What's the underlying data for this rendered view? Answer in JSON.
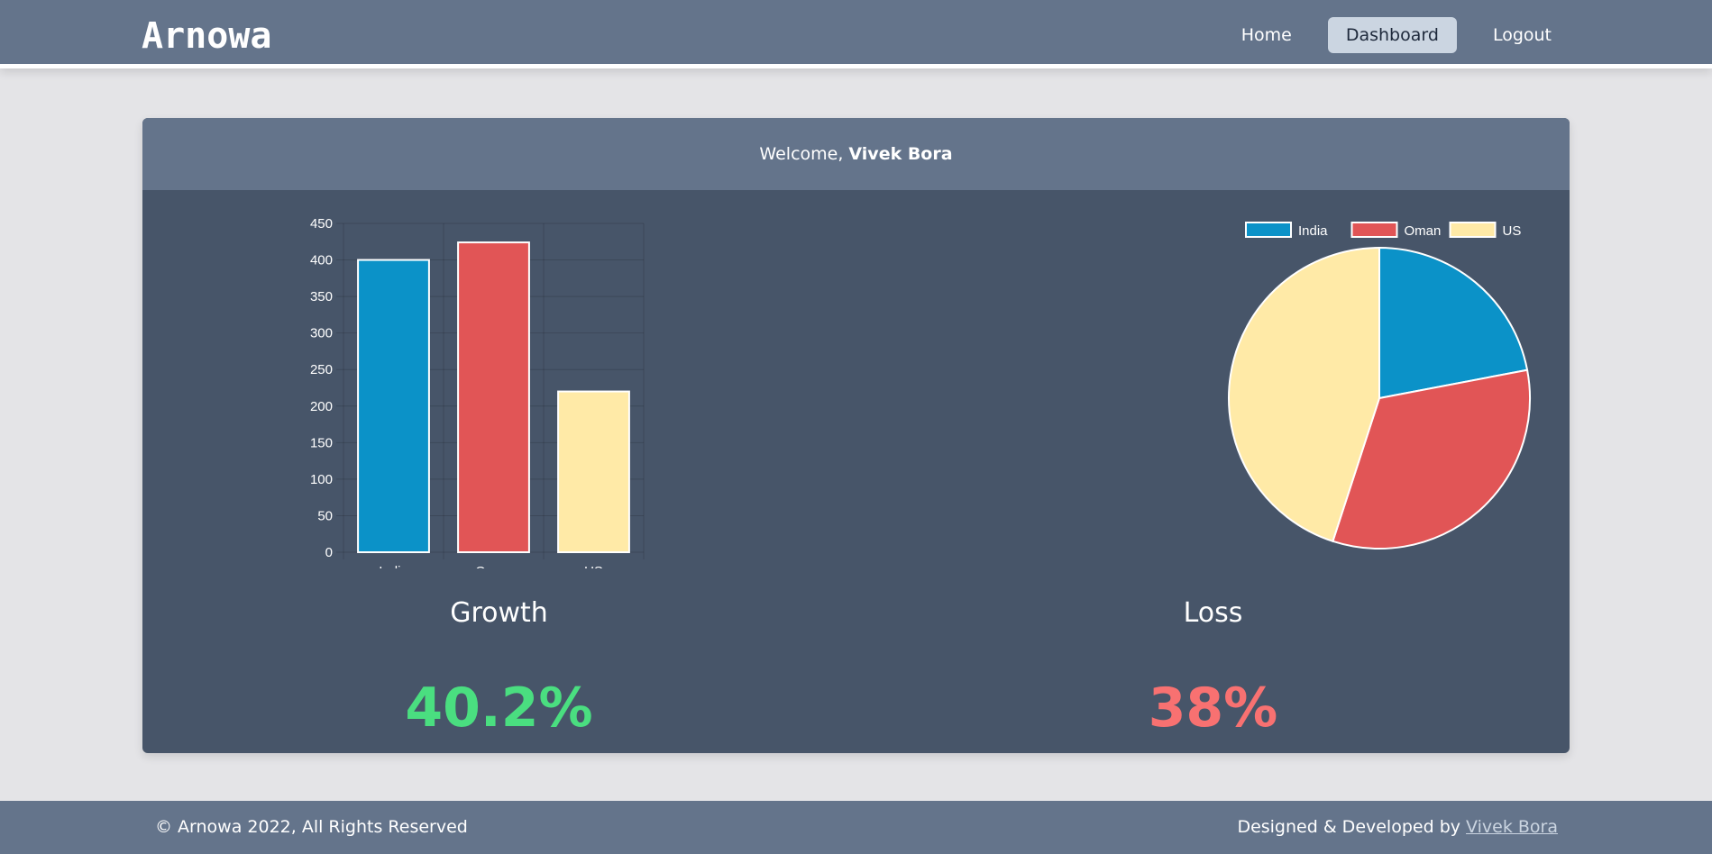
{
  "header": {
    "brand": "Arnowa",
    "nav": [
      {
        "label": "Home",
        "active": false
      },
      {
        "label": "Dashboard",
        "active": true
      },
      {
        "label": "Logout",
        "active": false
      }
    ]
  },
  "card": {
    "welcome_prefix": "Welcome,",
    "user_name": "Vivek Bora"
  },
  "stats": {
    "growth_label": "Growth",
    "growth_value": "40.2%",
    "growth_color": "#4ade80",
    "loss_label": "Loss",
    "loss_value": "38%",
    "loss_color": "#f87171"
  },
  "chart_data": [
    {
      "type": "bar",
      "categories": [
        "India",
        "Oman",
        "US"
      ],
      "values": [
        400,
        424,
        220
      ],
      "colors": [
        "#0b92c8",
        "#e15556",
        "#ffeaa7"
      ],
      "ylim": [
        0,
        450
      ],
      "yticks": [
        0,
        50,
        100,
        150,
        200,
        250,
        300,
        350,
        400,
        450
      ],
      "grid": true,
      "legend": "none"
    },
    {
      "type": "pie",
      "labels": [
        "India",
        "Oman",
        "US"
      ],
      "values": [
        22,
        33,
        45
      ],
      "colors": [
        "#0b92c8",
        "#e15556",
        "#ffeaa7"
      ],
      "legend": "top"
    }
  ],
  "footer": {
    "copyright": "© Arnowa 2022, All Rights Reserved",
    "credit_prefix": "Designed & Developed by",
    "credit_name": "Vivek Bora"
  }
}
